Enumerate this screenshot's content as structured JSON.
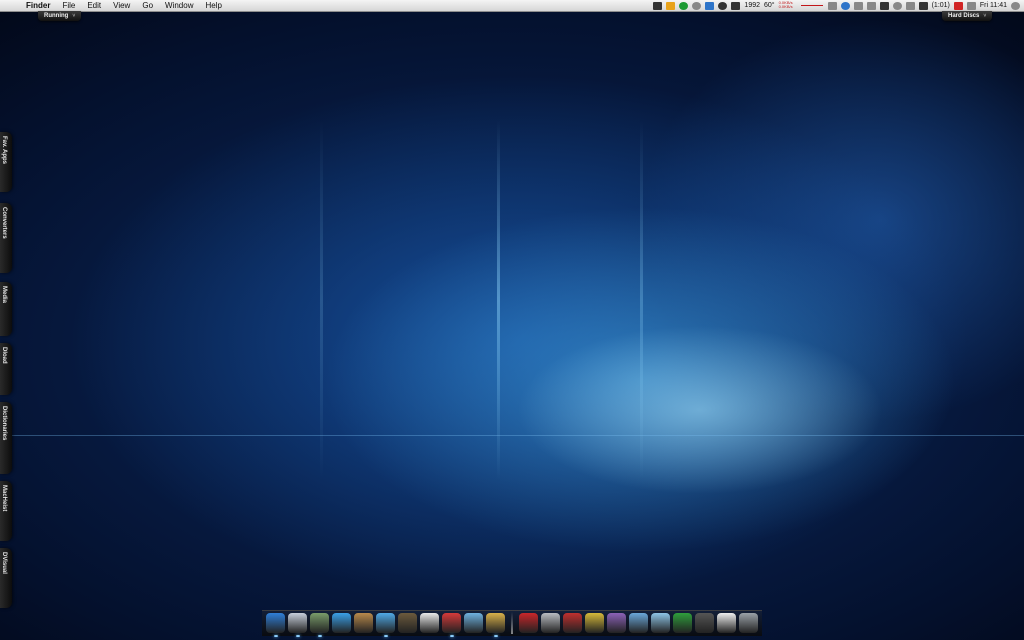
{
  "menubar": {
    "app_name": "Finder",
    "menus": [
      "File",
      "Edit",
      "View",
      "Go",
      "Window",
      "Help"
    ],
    "status": {
      "count_1": "1992",
      "temperature": "60°",
      "net_up": "0.0KB/s",
      "net_down": "0.0KB/s",
      "battery": "(1:01)",
      "clock": "Fri 11:41"
    }
  },
  "tabs": {
    "running": "Running",
    "hard_discs": "Hard Discs"
  },
  "side_drawers": [
    "Fav. Apps",
    "Converters",
    "Media",
    "Dload",
    "Dictionaries",
    "MacHeist",
    "DVisual"
  ],
  "dock": {
    "apps": [
      {
        "icon": "finder-icon",
        "color": "#2f7fd8",
        "running": true
      },
      {
        "icon": "mail-icon",
        "color": "#c7cfdb",
        "running": true
      },
      {
        "icon": "preview-icon",
        "color": "#7a9c6a",
        "running": true
      },
      {
        "icon": "safari-icon",
        "color": "#3aa0e8",
        "running": false
      },
      {
        "icon": "address-book-icon",
        "color": "#b98a4c",
        "running": false
      },
      {
        "icon": "itunes-icon",
        "color": "#4fa9e6",
        "running": true
      },
      {
        "icon": "iphoto-icon",
        "color": "#6c5a3d",
        "running": false
      },
      {
        "icon": "textedit-icon",
        "color": "#e9e9e9",
        "running": false
      },
      {
        "icon": "red-app-icon",
        "color": "#d43a3a",
        "running": true
      },
      {
        "icon": "scripteditor-icon",
        "color": "#6fb2e0",
        "running": false
      },
      {
        "icon": "package-icon",
        "color": "#d9b14a",
        "running": true
      }
    ],
    "folders": [
      {
        "icon": "red-drawer-icon",
        "color": "#c8262a"
      },
      {
        "icon": "grey-drawer-icon",
        "color": "#b9bcc1"
      },
      {
        "icon": "red-folder-icon",
        "color": "#c0302f"
      },
      {
        "icon": "yellow-folder-icon",
        "color": "#d6b93a"
      },
      {
        "icon": "purple-folder-icon",
        "color": "#8c62b8"
      },
      {
        "icon": "pictures-folder-icon",
        "color": "#6aa7d9"
      },
      {
        "icon": "network-folder-icon",
        "color": "#8ec4e6"
      },
      {
        "icon": "green-folder-icon",
        "color": "#2f9e3c"
      },
      {
        "icon": "disc-icon",
        "color": "#555555"
      },
      {
        "icon": "document-icon",
        "color": "#eeeeee"
      },
      {
        "icon": "trash-icon",
        "color": "#9aa1a8"
      }
    ]
  }
}
